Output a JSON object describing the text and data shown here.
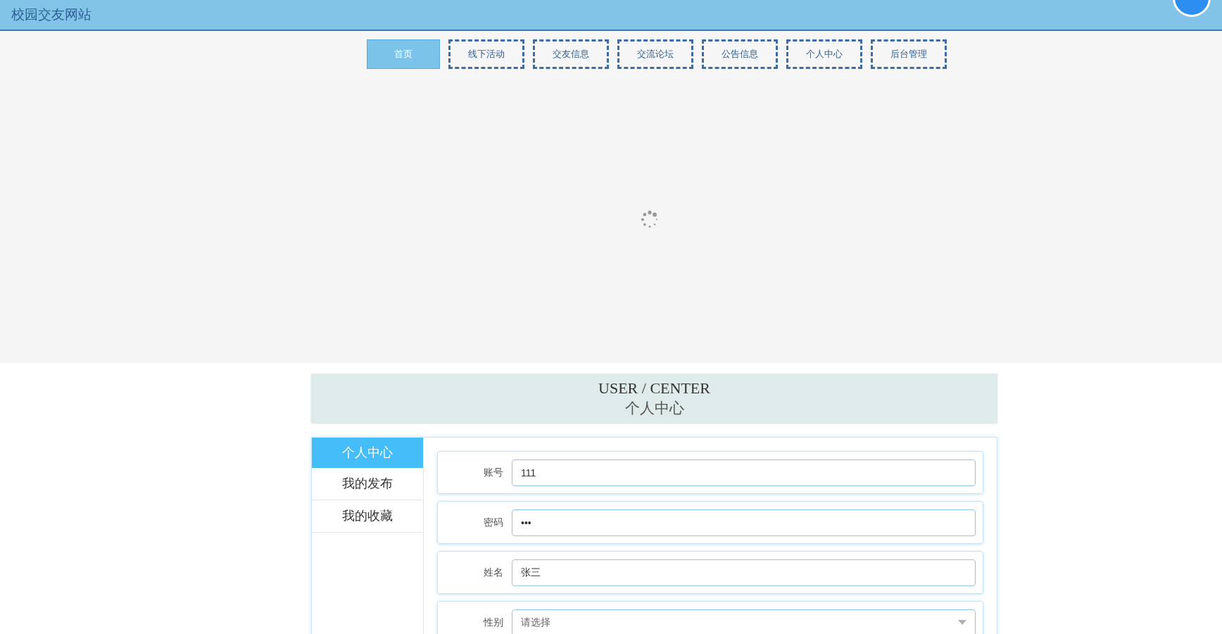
{
  "site_title": "校园交友网站",
  "nav": [
    {
      "label": "首页",
      "selected": true
    },
    {
      "label": "线下活动",
      "selected": false
    },
    {
      "label": "交友信息",
      "selected": false
    },
    {
      "label": "交流论坛",
      "selected": false
    },
    {
      "label": "公告信息",
      "selected": false
    },
    {
      "label": "个人中心",
      "selected": false
    },
    {
      "label": "后台管理",
      "selected": false
    }
  ],
  "banner": {
    "title_en": "USER / CENTER",
    "title_cn": "个人中心"
  },
  "sidebar": [
    {
      "label": "个人中心",
      "selected": true
    },
    {
      "label": "我的发布",
      "selected": false
    },
    {
      "label": "我的收藏",
      "selected": false
    }
  ],
  "form": [
    {
      "kind": "input",
      "label": "账号",
      "value": "111"
    },
    {
      "kind": "input",
      "label": "密码",
      "value": "•••"
    },
    {
      "kind": "input",
      "label": "姓名",
      "value": "张三"
    },
    {
      "kind": "select",
      "label": "性别",
      "value": "请选择"
    }
  ]
}
